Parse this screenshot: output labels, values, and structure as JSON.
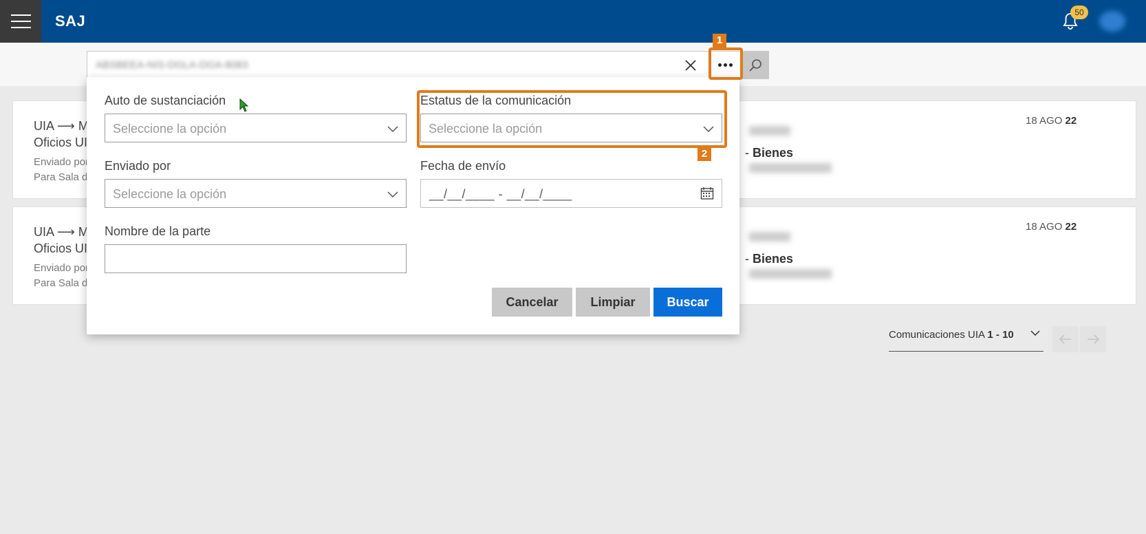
{
  "app": {
    "title": "SAJ",
    "notifications_count": "50"
  },
  "search": {
    "value": "ABSBEEA-NIS-DGLA-DGA-8083"
  },
  "dialog": {
    "fields": {
      "auto": {
        "label": "Auto de sustanciación",
        "placeholder": "Seleccione la opción"
      },
      "estatus": {
        "label": "Estatus de la comunicación",
        "placeholder": "Seleccione la opción"
      },
      "enviado": {
        "label": "Enviado por",
        "placeholder": "Seleccione la opción"
      },
      "fecha": {
        "label": "Fecha de envío",
        "mask": "__/__/____ - __/__/____"
      },
      "nombre": {
        "label": "Nombre de la parte",
        "value": ""
      }
    },
    "buttons": {
      "cancel": "Cancelar",
      "clear": "Limpiar",
      "search": "Buscar"
    }
  },
  "annotations": {
    "one": "1",
    "two": "2",
    "color": "#e07b1a"
  },
  "cards": [
    {
      "line1": "UIA ⟶ M",
      "line2": "Oficios UI",
      "line3": "Enviado por",
      "line4": "Para Sala de",
      "date_day": "18 AGO",
      "date_year": "22",
      "dash": "- ",
      "tag": "Bienes"
    },
    {
      "line1": "UIA ⟶ M",
      "line2": "Oficios UI",
      "line3": "Enviado por",
      "line4": "Para Sala de",
      "date_day": "18 AGO",
      "date_year": "22",
      "dash": "- ",
      "tag": "Bienes"
    }
  ],
  "pager": {
    "label": "Comunicaciones UIA",
    "range": "1 - 10"
  },
  "colors": {
    "topbar": "#004b8d",
    "primary_button": "#0a6ed8",
    "background": "#eaeaea"
  }
}
